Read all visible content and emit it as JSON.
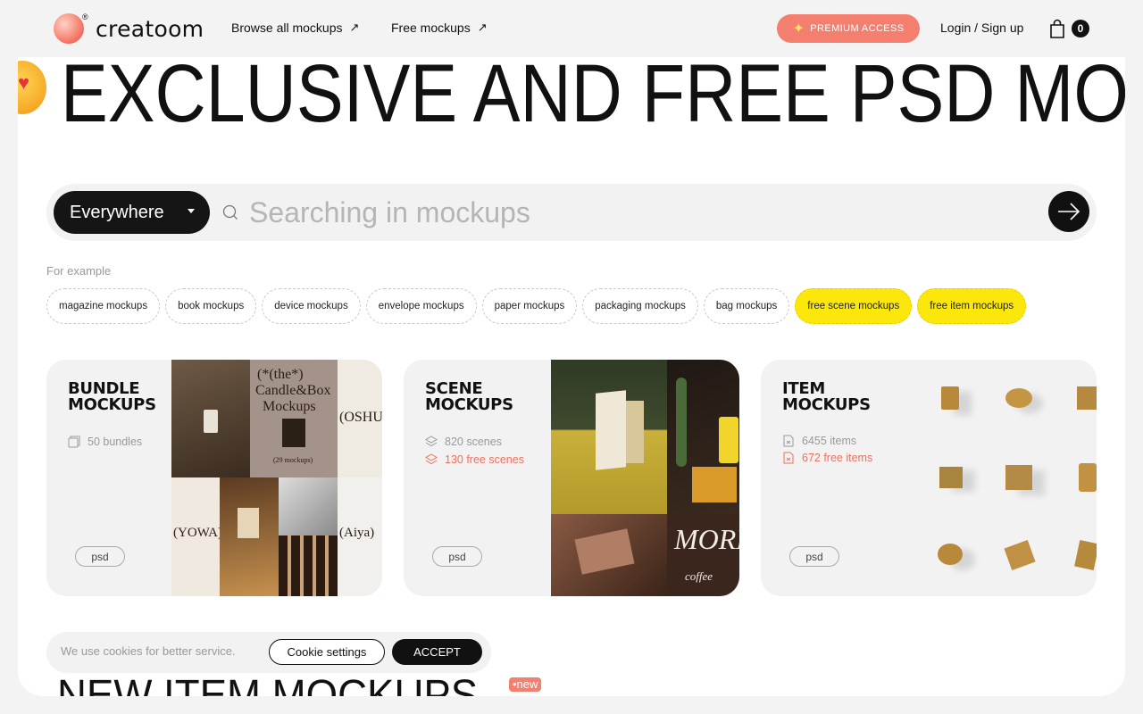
{
  "header": {
    "logo_text": "creatoom",
    "logo_mark": "®",
    "nav": [
      {
        "label": "Browse all mockups",
        "icon": "arrow-up-right-icon"
      },
      {
        "label": "Free mockups",
        "icon": "arrow-up-right-icon"
      }
    ],
    "premium_label": "PREMIUM ACCESS",
    "login_label": "Login / Sign up",
    "cart_count": "0"
  },
  "hero": {
    "marquee_text": "EXCLUSIVE AND FREE PSD MOCKUPS"
  },
  "search": {
    "scope_label": "Everywhere",
    "placeholder": "Searching in mockups",
    "value": ""
  },
  "examples": {
    "label": "For example",
    "chips": [
      {
        "label": "magazine mockups",
        "highlight": false
      },
      {
        "label": "book mockups",
        "highlight": false
      },
      {
        "label": "device mockups",
        "highlight": false
      },
      {
        "label": "envelope mockups",
        "highlight": false
      },
      {
        "label": "paper mockups",
        "highlight": false
      },
      {
        "label": "packaging mockups",
        "highlight": false
      },
      {
        "label": "bag mockups",
        "highlight": false
      },
      {
        "label": "free scene mockups",
        "highlight": true
      },
      {
        "label": "free item mockups",
        "highlight": true
      }
    ]
  },
  "cards": [
    {
      "title_line1": "BUNDLE",
      "title_line2": "MOCKUPS",
      "stat": "50 bundles",
      "free_stat": "",
      "badge": "psd",
      "tile_texts": [
        "(*(the*)",
        "Candle&Box",
        "Mockups",
        "(29 mockups)",
        "(OSHU)",
        "(YOWA)",
        "(Aiya)"
      ]
    },
    {
      "title_line1": "SCENE",
      "title_line2": "MOCKUPS",
      "stat": "820 scenes",
      "free_stat": "130 free scenes",
      "badge": "psd",
      "tile_texts": [
        "MORE",
        "coffee"
      ]
    },
    {
      "title_line1": "ITEM",
      "title_line2": "MOCKUPS",
      "stat": "6455 items",
      "free_stat": "672 free items",
      "badge": "psd",
      "tile_texts": []
    }
  ],
  "cookie": {
    "text": "We use cookies for better service.",
    "settings_label": "Cookie settings",
    "accept_label": "ACCEPT"
  },
  "section": {
    "heading": "NEW ITEM MOCKUPS",
    "badge": "•new"
  },
  "colors": {
    "accent": "#f47f6f",
    "highlight": "#fbe70b",
    "dark": "#111111"
  }
}
